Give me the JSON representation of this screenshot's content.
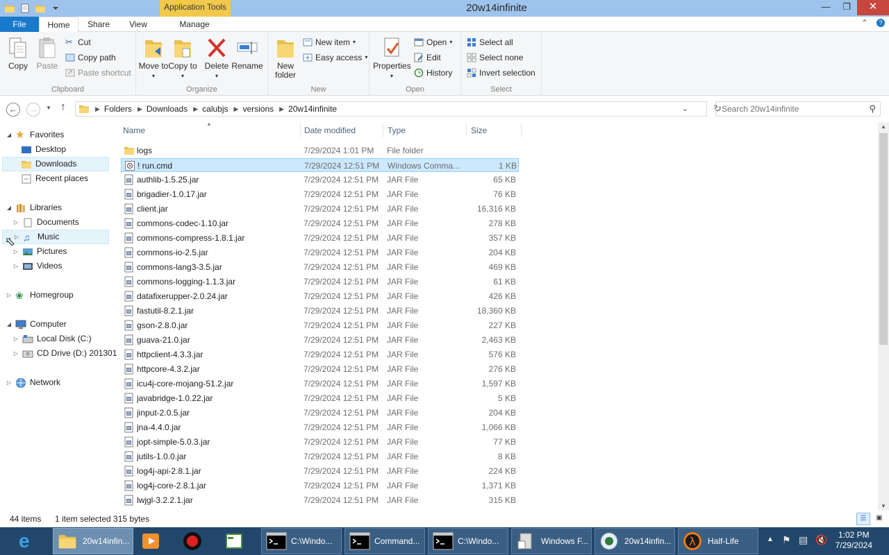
{
  "window": {
    "title": "20w14infinite",
    "context_tab": "Application Tools"
  },
  "ribbon": {
    "tabs": [
      "File",
      "Home",
      "Share",
      "View",
      "Manage"
    ],
    "clipboard": {
      "label": "Clipboard",
      "copy": "Copy",
      "paste": "Paste",
      "cut": "Cut",
      "copy_path": "Copy path",
      "paste_shortcut": "Paste shortcut"
    },
    "organize": {
      "label": "Organize",
      "move_to": "Move to",
      "copy_to": "Copy to",
      "delete": "Delete",
      "rename": "Rename"
    },
    "new": {
      "label": "New",
      "new_folder": "New folder",
      "new_item": "New item",
      "easy_access": "Easy access"
    },
    "open": {
      "label": "Open",
      "properties": "Properties",
      "open": "Open",
      "edit": "Edit",
      "history": "History"
    },
    "select": {
      "label": "Select",
      "select_all": "Select all",
      "select_none": "Select none",
      "invert": "Invert selection"
    }
  },
  "address": {
    "crumbs": [
      "Folders",
      "Downloads",
      "calubjs",
      "versions",
      "20w14infinite"
    ],
    "search_placeholder": "Search 20w14infinite"
  },
  "nav": {
    "favorites": "Favorites",
    "desktop": "Desktop",
    "downloads": "Downloads",
    "recent": "Recent places",
    "libraries": "Libraries",
    "documents": "Documents",
    "music": "Music",
    "pictures": "Pictures",
    "videos": "Videos",
    "homegroup": "Homegroup",
    "computer": "Computer",
    "local_disk": "Local Disk (C:)",
    "cd_drive": "CD Drive (D:) 201301",
    "network": "Network"
  },
  "columns": {
    "name": "Name",
    "date": "Date modified",
    "type": "Type",
    "size": "Size"
  },
  "files": [
    {
      "name": "logs",
      "date": "7/29/2024 1:01 PM",
      "type": "File folder",
      "size": "",
      "icon": "folder-icon"
    },
    {
      "name": "! run.cmd",
      "date": "7/29/2024 12:51 PM",
      "type": "Windows Comma...",
      "size": "1 KB",
      "icon": "cmd-file-icon"
    },
    {
      "name": "authlib-1.5.25.jar",
      "date": "7/29/2024 12:51 PM",
      "type": "JAR File",
      "size": "65 KB",
      "icon": "jar-file-icon"
    },
    {
      "name": "brigadier-1.0.17.jar",
      "date": "7/29/2024 12:51 PM",
      "type": "JAR File",
      "size": "76 KB",
      "icon": "jar-file-icon"
    },
    {
      "name": "client.jar",
      "date": "7/29/2024 12:51 PM",
      "type": "JAR File",
      "size": "16,316 KB",
      "icon": "jar-file-icon"
    },
    {
      "name": "commons-codec-1.10.jar",
      "date": "7/29/2024 12:51 PM",
      "type": "JAR File",
      "size": "278 KB",
      "icon": "jar-file-icon"
    },
    {
      "name": "commons-compress-1.8.1.jar",
      "date": "7/29/2024 12:51 PM",
      "type": "JAR File",
      "size": "357 KB",
      "icon": "jar-file-icon"
    },
    {
      "name": "commons-io-2.5.jar",
      "date": "7/29/2024 12:51 PM",
      "type": "JAR File",
      "size": "204 KB",
      "icon": "jar-file-icon"
    },
    {
      "name": "commons-lang3-3.5.jar",
      "date": "7/29/2024 12:51 PM",
      "type": "JAR File",
      "size": "469 KB",
      "icon": "jar-file-icon"
    },
    {
      "name": "commons-logging-1.1.3.jar",
      "date": "7/29/2024 12:51 PM",
      "type": "JAR File",
      "size": "61 KB",
      "icon": "jar-file-icon"
    },
    {
      "name": "datafixerupper-2.0.24.jar",
      "date": "7/29/2024 12:51 PM",
      "type": "JAR File",
      "size": "426 KB",
      "icon": "jar-file-icon"
    },
    {
      "name": "fastutil-8.2.1.jar",
      "date": "7/29/2024 12:51 PM",
      "type": "JAR File",
      "size": "18,360 KB",
      "icon": "jar-file-icon"
    },
    {
      "name": "gson-2.8.0.jar",
      "date": "7/29/2024 12:51 PM",
      "type": "JAR File",
      "size": "227 KB",
      "icon": "jar-file-icon"
    },
    {
      "name": "guava-21.0.jar",
      "date": "7/29/2024 12:51 PM",
      "type": "JAR File",
      "size": "2,463 KB",
      "icon": "jar-file-icon"
    },
    {
      "name": "httpclient-4.3.3.jar",
      "date": "7/29/2024 12:51 PM",
      "type": "JAR File",
      "size": "576 KB",
      "icon": "jar-file-icon"
    },
    {
      "name": "httpcore-4.3.2.jar",
      "date": "7/29/2024 12:51 PM",
      "type": "JAR File",
      "size": "276 KB",
      "icon": "jar-file-icon"
    },
    {
      "name": "icu4j-core-mojang-51.2.jar",
      "date": "7/29/2024 12:51 PM",
      "type": "JAR File",
      "size": "1,597 KB",
      "icon": "jar-file-icon"
    },
    {
      "name": "javabridge-1.0.22.jar",
      "date": "7/29/2024 12:51 PM",
      "type": "JAR File",
      "size": "5 KB",
      "icon": "jar-file-icon"
    },
    {
      "name": "jinput-2.0.5.jar",
      "date": "7/29/2024 12:51 PM",
      "type": "JAR File",
      "size": "204 KB",
      "icon": "jar-file-icon"
    },
    {
      "name": "jna-4.4.0.jar",
      "date": "7/29/2024 12:51 PM",
      "type": "JAR File",
      "size": "1,066 KB",
      "icon": "jar-file-icon"
    },
    {
      "name": "jopt-simple-5.0.3.jar",
      "date": "7/29/2024 12:51 PM",
      "type": "JAR File",
      "size": "77 KB",
      "icon": "jar-file-icon"
    },
    {
      "name": "jutils-1.0.0.jar",
      "date": "7/29/2024 12:51 PM",
      "type": "JAR File",
      "size": "8 KB",
      "icon": "jar-file-icon"
    },
    {
      "name": "log4j-api-2.8.1.jar",
      "date": "7/29/2024 12:51 PM",
      "type": "JAR File",
      "size": "224 KB",
      "icon": "jar-file-icon"
    },
    {
      "name": "log4j-core-2.8.1.jar",
      "date": "7/29/2024 12:51 PM",
      "type": "JAR File",
      "size": "1,371 KB",
      "icon": "jar-file-icon"
    },
    {
      "name": "lwjgl-3.2.2.1.jar",
      "date": "7/29/2024 12:51 PM",
      "type": "JAR File",
      "size": "315 KB",
      "icon": "jar-file-icon"
    }
  ],
  "selected_index": 1,
  "status": {
    "items": "44 items",
    "selected": "1 item selected  315 bytes"
  },
  "taskbar": {
    "items": [
      {
        "label": "",
        "icon": "internet-explorer-icon"
      },
      {
        "label": "20w14infin...",
        "icon": "folder-icon",
        "state": "active"
      },
      {
        "label": "",
        "icon": "media-player-icon"
      },
      {
        "label": "",
        "icon": "record-icon"
      },
      {
        "label": "",
        "icon": "app-window-icon"
      },
      {
        "label": "C:\\Windo...",
        "icon": "console-icon",
        "state": "framed"
      },
      {
        "label": "Command...",
        "icon": "console-icon",
        "state": "framed"
      },
      {
        "label": "C:\\Windo...",
        "icon": "console-icon",
        "state": "framed"
      },
      {
        "label": "Windows F...",
        "icon": "windows-features-icon",
        "state": "framed"
      },
      {
        "label": "20w14infin...",
        "icon": "java-icon",
        "state": "framed"
      },
      {
        "label": "Half-Life",
        "icon": "half-life-icon",
        "state": "framed"
      }
    ],
    "time": "1:02 PM",
    "date": "7/29/2024"
  },
  "colors": {
    "accent": "#1979ca",
    "selection": "#cce8ff",
    "taskbar": "#22476a",
    "context_tab": "#f1c84b"
  }
}
